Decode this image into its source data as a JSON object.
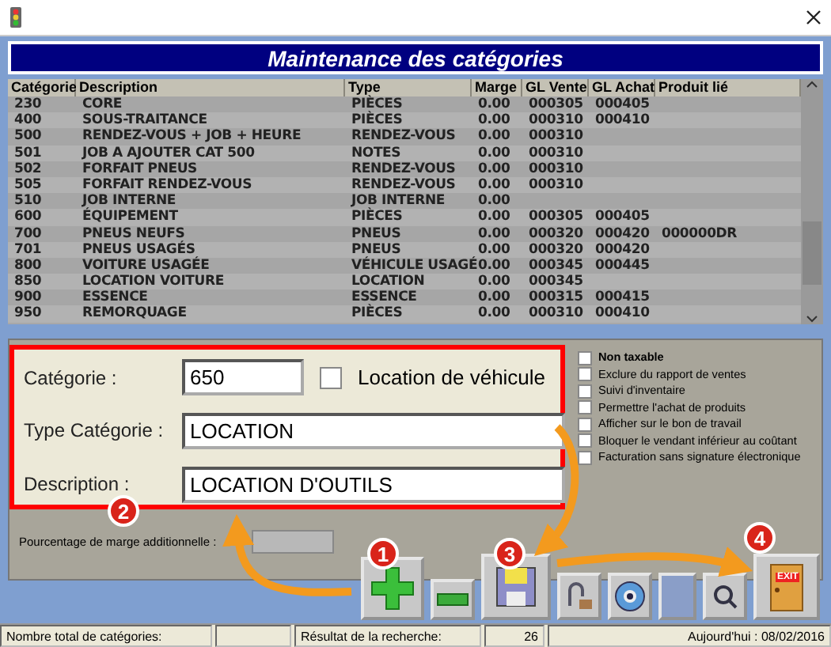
{
  "header": {
    "title": "Maintenance des catégories"
  },
  "table": {
    "columns": [
      "Catégorie",
      "Description",
      "Type",
      "Marge",
      "GL Vente",
      "GL Achat",
      "Produit lié"
    ],
    "rows": [
      [
        "230",
        "CORE",
        "PIÈCES",
        "0.00",
        "000305",
        "000405",
        ""
      ],
      [
        "400",
        "SOUS-TRAITANCE",
        "PIÈCES",
        "0.00",
        "000310",
        "000410",
        ""
      ],
      [
        "500",
        "RENDEZ-VOUS + JOB + HEURE",
        "RENDEZ-VOUS",
        "0.00",
        "000310",
        "",
        ""
      ],
      [
        "501",
        "JOB A AJOUTER CAT 500",
        "NOTES",
        "0.00",
        "000310",
        "",
        ""
      ],
      [
        "502",
        "FORFAIT PNEUS",
        "RENDEZ-VOUS",
        "0.00",
        "000310",
        "",
        ""
      ],
      [
        "505",
        "FORFAIT RENDEZ-VOUS",
        "RENDEZ-VOUS",
        "0.00",
        "000310",
        "",
        ""
      ],
      [
        "510",
        "JOB INTERNE",
        "JOB INTERNE",
        "0.00",
        "",
        "",
        ""
      ],
      [
        "600",
        "ÉQUIPEMENT",
        "PIÈCES",
        "0.00",
        "000305",
        "000405",
        ""
      ],
      [
        "700",
        "PNEUS NEUFS",
        "PNEUS",
        "0.00",
        "000320",
        "000420",
        "000000DR"
      ],
      [
        "701",
        "PNEUS USAGÉS",
        "PNEUS",
        "0.00",
        "000320",
        "000420",
        ""
      ],
      [
        "800",
        "VOITURE USAGÉE",
        "VÉHICULE USAGÉ",
        "0.00",
        "000345",
        "000445",
        ""
      ],
      [
        "850",
        "LOCATION VOITURE",
        "LOCATION",
        "0.00",
        "000345",
        "",
        ""
      ],
      [
        "900",
        "ESSENCE",
        "ESSENCE",
        "0.00",
        "000315",
        "000415",
        ""
      ],
      [
        "950",
        "REMORQUAGE",
        "PIÈCES",
        "0.00",
        "000310",
        "000410",
        ""
      ]
    ]
  },
  "form": {
    "category_label": "Catégorie :",
    "category_value": "650",
    "vehicle_rental": {
      "label": "Location de véhicule",
      "checked": false
    },
    "type_label": "Type Catégorie :",
    "type_value": "LOCATION",
    "description_label": "Description :",
    "description_value": "LOCATION D'OUTILS"
  },
  "options": [
    {
      "label": "Non taxable",
      "checked": false,
      "bold": true
    },
    {
      "label": "Exclure du rapport de ventes",
      "checked": false,
      "bold": false
    },
    {
      "label": "Suivi d'inventaire",
      "checked": false,
      "bold": false
    },
    {
      "label": "Permettre l'achat de produits",
      "checked": false,
      "bold": false
    },
    {
      "label": "Afficher sur le bon de travail",
      "checked": false,
      "bold": false
    },
    {
      "label": "Bloquer le vendant inférieur au coûtant",
      "checked": false,
      "bold": false
    },
    {
      "label": "Facturation sans signature électronique",
      "checked": false,
      "bold": false
    }
  ],
  "margin": {
    "label": "Pourcentage de marge additionnelle :"
  },
  "toolbar": [
    {
      "kind": "add"
    },
    {
      "kind": "remove"
    },
    {
      "kind": "save"
    },
    {
      "kind": "tool"
    },
    {
      "kind": "eye"
    },
    {
      "kind": "blank"
    },
    {
      "kind": "search"
    },
    {
      "kind": "exit",
      "label": "EXIT"
    }
  ],
  "callouts": [
    "1",
    "2",
    "3",
    "4"
  ],
  "status_bar": {
    "total_label": "Nombre total de catégories:",
    "result_label": "Résultat de la recherche:",
    "result_count": "26",
    "date": "Aujourd'hui : 08/02/2016"
  }
}
